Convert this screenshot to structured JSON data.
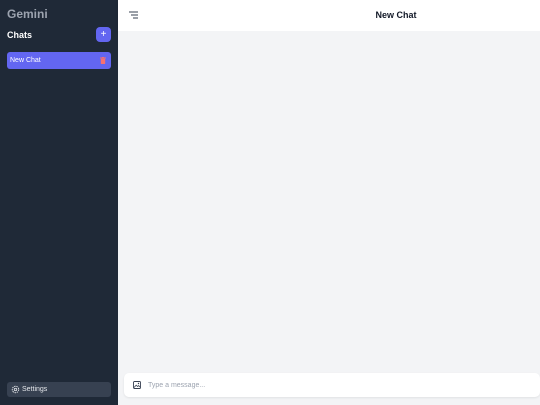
{
  "sidebar": {
    "app_title": "Gemini",
    "chats_heading": "Chats",
    "new_chat_button_symbol": "+",
    "items": [
      {
        "label": "New Chat",
        "active": true,
        "action_icon": "trash-icon"
      }
    ],
    "settings_label": "Settings",
    "settings_icon": "gear-icon"
  },
  "header": {
    "title": "New Chat",
    "menu_icon": "menu-icon"
  },
  "composer": {
    "attach_icon": "image-icon",
    "placeholder": "Type a message..."
  },
  "colors": {
    "sidebar_bg": "#1f2937",
    "accent": "#6366f1",
    "delete": "#f87171",
    "main_bg": "#f3f4f6"
  }
}
